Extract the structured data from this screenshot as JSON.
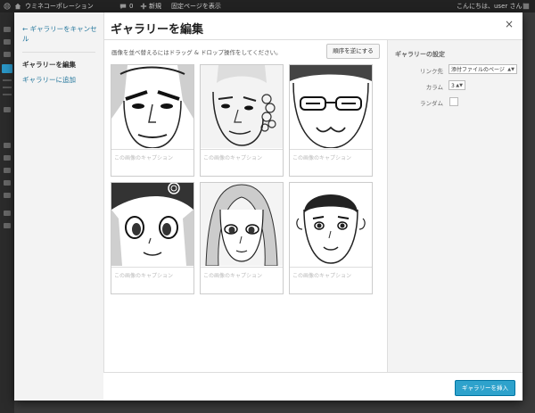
{
  "admin_bar": {
    "site_name": "ウミネコーポレーション",
    "comments_count": "0",
    "new_label": "新規",
    "view_page_label": "固定ページを表示",
    "greeting": "こんにちは、user さん！"
  },
  "menu": {
    "cancel_label": "← ギャラリーをキャンセル",
    "edit_label": "ギャラリーを編集",
    "add_label": "ギャラリーに追加"
  },
  "modal": {
    "title": "ギャラリーを編集",
    "close_icon": "×"
  },
  "content": {
    "instructions": "画像を並べ替えるにはドラッグ & ドロップ操作をしてください。",
    "reverse_button": "順序を逆にする"
  },
  "attachments": [
    {
      "subject": "man with furrowed brow",
      "caption_placeholder": "この画像のキャプション"
    },
    {
      "subject": "man with curly hair",
      "caption_placeholder": "この画像のキャプション"
    },
    {
      "subject": "man with glasses",
      "caption_placeholder": "この画像のキャプション"
    },
    {
      "subject": "girl with headband",
      "caption_placeholder": "この画像のキャプション"
    },
    {
      "subject": "woman with long hair",
      "caption_placeholder": "この画像のキャプション"
    },
    {
      "subject": "boy with short hair",
      "caption_placeholder": "この画像のキャプション"
    }
  ],
  "settings": {
    "heading": "ギャラリーの設定",
    "link_label": "リンク先",
    "link_value": "添付ファイルのページ",
    "columns_label": "カラム",
    "columns_value": "3",
    "random_label": "ランダム",
    "random_checked": false
  },
  "footer": {
    "insert_button": "ギャラリーを挿入"
  },
  "colors": {
    "accent": "#2ea2cc",
    "link": "#21759b",
    "admin_bar": "#222222"
  }
}
